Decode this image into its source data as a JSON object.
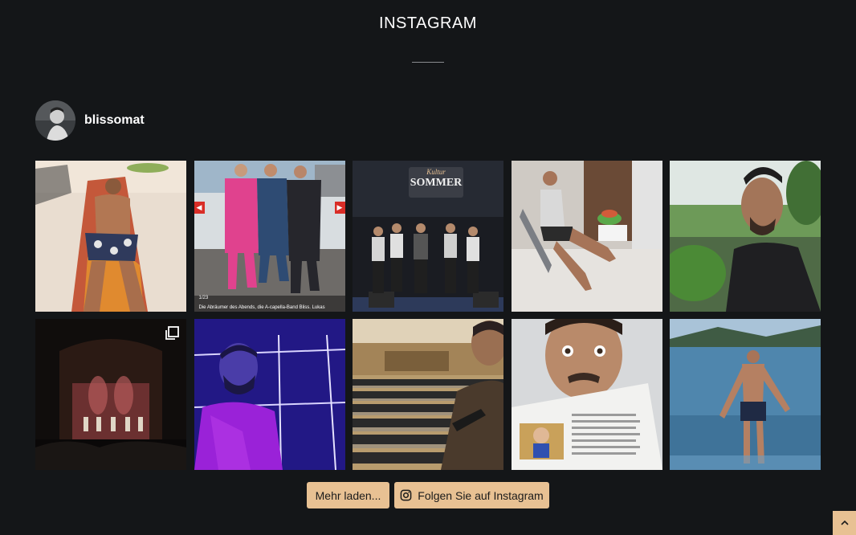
{
  "section": {
    "title": "INSTAGRAM"
  },
  "profile": {
    "username": "blissomat",
    "avatar_icon": "profile-photo"
  },
  "posts": [
    {
      "label": "post-beach-sunbathing"
    },
    {
      "label": "post-newspaper-award",
      "page_indicator": "1/23",
      "caption": "Die Abräumer des Abends, die A-capella-Band Bliss. Lukas",
      "multi": true
    },
    {
      "label": "post-kultur-sommer-stage",
      "sign_top": "Kultur",
      "sign_main": "SOMMER"
    },
    {
      "label": "post-terrace-chair"
    },
    {
      "label": "post-selfie-park"
    },
    {
      "label": "post-theater-stage",
      "multi": true
    },
    {
      "label": "post-purple-selfie"
    },
    {
      "label": "post-concert-hall-seats"
    },
    {
      "label": "post-newspaper-selfie"
    },
    {
      "label": "post-lake-swim"
    }
  ],
  "buttons": {
    "load_more": "Mehr laden...",
    "follow": "Folgen Sie auf Instagram"
  },
  "scroll_top_icon": "chevron-up-icon",
  "colors": {
    "background": "#141618",
    "button": "#e8c193",
    "button_text": "#1b1b1b"
  }
}
